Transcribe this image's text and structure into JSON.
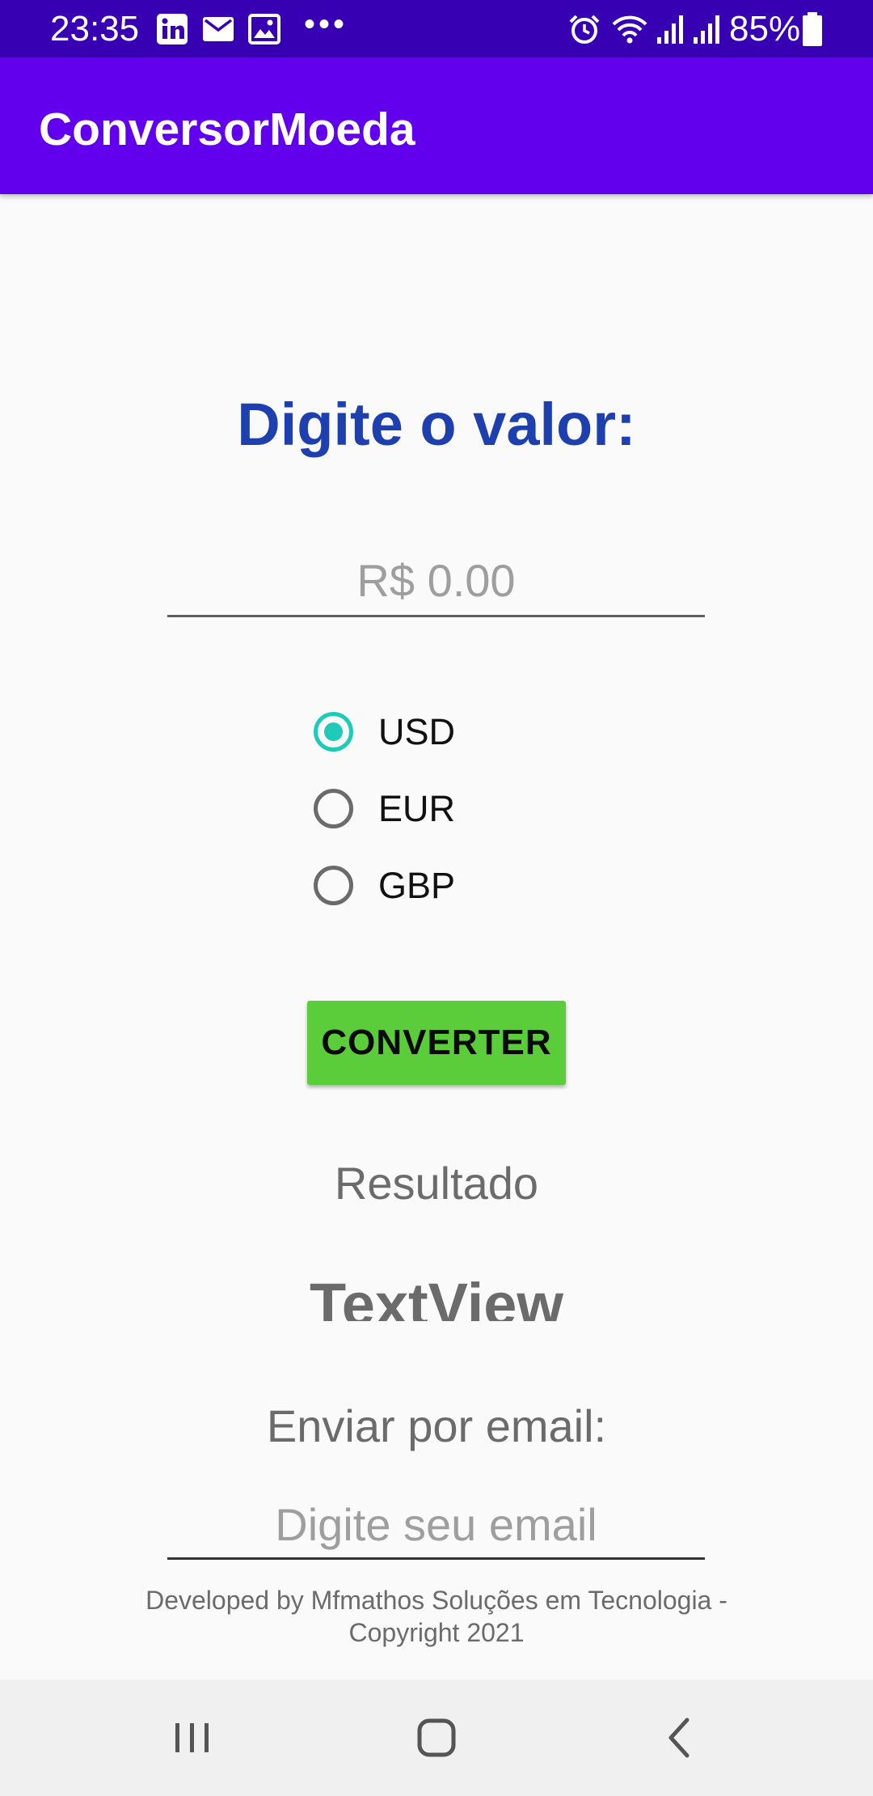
{
  "status_bar": {
    "time": "23:35",
    "battery_text": "85%",
    "icons": [
      "linkedin-icon",
      "mail-icon",
      "gallery-icon",
      "more-notifications-icon",
      "alarm-icon",
      "wifi-icon",
      "signal-icon",
      "signal-icon",
      "battery-icon"
    ]
  },
  "app_bar": {
    "title": "ConversorMoeda"
  },
  "form": {
    "heading": "Digite o valor:",
    "amount_placeholder": "R$ 0.00",
    "currencies": [
      {
        "label": "USD",
        "checked": true
      },
      {
        "label": "EUR",
        "checked": false
      },
      {
        "label": "GBP",
        "checked": false
      }
    ],
    "convert_label": "CONVERTER",
    "result_label": "Resultado",
    "result_value": "TextView",
    "email_label": "Enviar por email:",
    "email_placeholder": "Digite seu email"
  },
  "footer": {
    "line1": "Developed by Mfmathos Soluções em Tecnologia -",
    "line2": "Copyright 2021"
  },
  "nav_bar": {
    "icons": [
      "recent-apps-icon",
      "home-icon",
      "back-icon"
    ]
  },
  "colors": {
    "status_bar": "#3700b3",
    "app_bar": "#6200ee",
    "heading": "#1e40af",
    "radio_accent": "#1ecbb9",
    "button": "#5bcc3a"
  }
}
